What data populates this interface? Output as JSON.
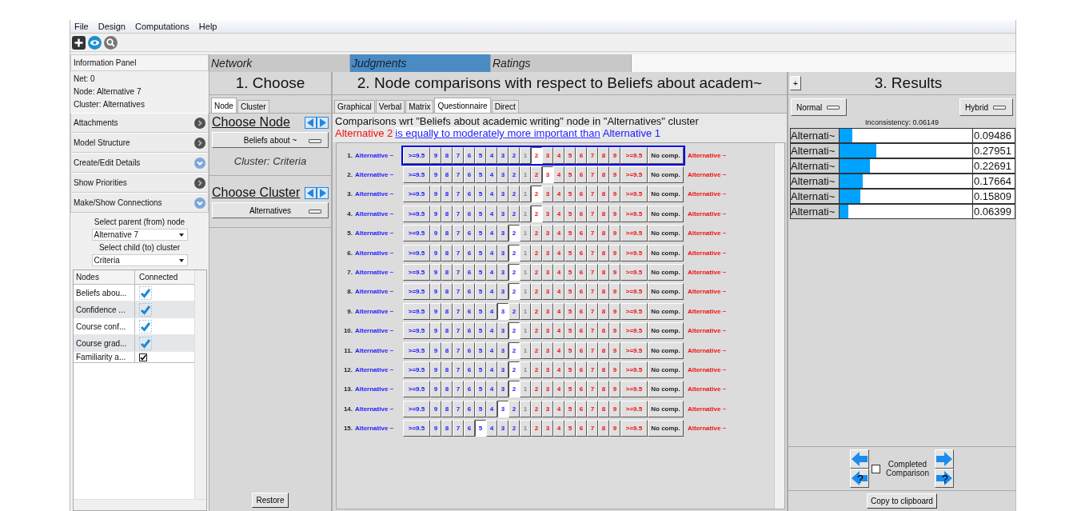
{
  "menu": [
    "File",
    "Design",
    "Computations",
    "Help"
  ],
  "info_panel": {
    "title": "Information Panel",
    "lines": [
      "Net: 0",
      "Node: Alternative 7",
      "Cluster: Alternatives"
    ]
  },
  "sections": [
    {
      "label": "Attachments",
      "highlighted": false
    },
    {
      "label": "Model Structure",
      "highlighted": false
    },
    {
      "label": "Create/Edit Details",
      "highlighted": true
    },
    {
      "label": "Show Priorities",
      "highlighted": false
    },
    {
      "label": "Make/Show Connections",
      "highlighted": true
    }
  ],
  "connections": {
    "parent_label": "Select parent (from) node",
    "parent_value": "Alternative 7",
    "child_label": "Select child (to) cluster",
    "child_value": "Criteria",
    "columns": [
      "Nodes",
      "Connected"
    ],
    "rows": [
      {
        "node": "Beliefs abou...",
        "checked": true,
        "kind": "tick"
      },
      {
        "node": "Confidence ...",
        "checked": true,
        "kind": "tick"
      },
      {
        "node": "Course conf...",
        "checked": true,
        "kind": "tick"
      },
      {
        "node": "Course grad...",
        "checked": true,
        "kind": "tick"
      },
      {
        "node": "Familiarity a...",
        "checked": true,
        "kind": "checkbox"
      }
    ]
  },
  "main_tabs": [
    {
      "label": "Network",
      "selected": false
    },
    {
      "label": "Judgments",
      "selected": true
    },
    {
      "label": "Ratings",
      "selected": false
    }
  ],
  "choose": {
    "title": "1. Choose",
    "tabs": [
      {
        "label": "Node",
        "selected": true
      },
      {
        "label": "Cluster",
        "selected": false
      }
    ],
    "node_heading": "Choose Node",
    "node_value": "Beliefs about ~",
    "cluster_note": "Cluster: Criteria",
    "cluster_heading": "Choose Cluster",
    "cluster_value": "Alternatives",
    "restore": "Restore"
  },
  "comparisons": {
    "title": "2. Node comparisons with respect to Beliefs about academ~",
    "tabs": [
      {
        "label": "Graphical",
        "selected": false
      },
      {
        "label": "Verbal",
        "selected": false
      },
      {
        "label": "Matrix",
        "selected": false
      },
      {
        "label": "Questionnaire",
        "selected": true
      },
      {
        "label": "Direct",
        "selected": false
      }
    ],
    "description": "Comparisons wrt \"Beliefs about academic writing\" node in \"Alternatives\" cluster",
    "verbal": {
      "left": "Alternative 2",
      "link": "is equally to moderately more important than",
      "right": "Alternative 1"
    },
    "rows": [
      {
        "number": "1.",
        "left": "Alternative ~",
        "right": "Alternative ~",
        "focused": true,
        "left_buttons": [
          {
            "label": ">=9.5",
            "selected": false
          },
          {
            "label": "9",
            "selected": false
          },
          {
            "label": "8",
            "selected": false
          },
          {
            "label": "7",
            "selected": false
          },
          {
            "label": "6",
            "selected": false
          },
          {
            "label": "5",
            "selected": false
          },
          {
            "label": "4",
            "selected": false
          },
          {
            "label": "3",
            "selected": false
          },
          {
            "label": "2",
            "selected": false
          }
        ],
        "center_button": {
          "label": "1",
          "selected": false
        },
        "right_buttons": [
          {
            "label": "2",
            "selected": true
          },
          {
            "label": "3",
            "selected": false
          },
          {
            "label": "4",
            "selected": false
          },
          {
            "label": "5",
            "selected": false
          },
          {
            "label": "6",
            "selected": false
          },
          {
            "label": "7",
            "selected": false
          },
          {
            "label": "8",
            "selected": false
          },
          {
            "label": "9",
            "selected": false
          },
          {
            "label": ">=9.5",
            "selected": false
          }
        ],
        "no_comp_button": {
          "label": "No comp.",
          "selected": false
        }
      },
      {
        "number": "2.",
        "left": "Alternative ~",
        "right": "Alternative ~",
        "focused": false,
        "left_buttons": [
          {
            "label": ">=9.5",
            "selected": false
          },
          {
            "label": "9",
            "selected": false
          },
          {
            "label": "8",
            "selected": false
          },
          {
            "label": "7",
            "selected": false
          },
          {
            "label": "6",
            "selected": false
          },
          {
            "label": "5",
            "selected": false
          },
          {
            "label": "4",
            "selected": false
          },
          {
            "label": "3",
            "selected": false
          },
          {
            "label": "2",
            "selected": false
          }
        ],
        "center_button": {
          "label": "1",
          "selected": false
        },
        "right_buttons": [
          {
            "label": "2",
            "selected": false
          },
          {
            "label": "3",
            "selected": true
          },
          {
            "label": "4",
            "selected": false
          },
          {
            "label": "5",
            "selected": false
          },
          {
            "label": "6",
            "selected": false
          },
          {
            "label": "7",
            "selected": false
          },
          {
            "label": "8",
            "selected": false
          },
          {
            "label": "9",
            "selected": false
          },
          {
            "label": ">=9.5",
            "selected": false
          }
        ],
        "no_comp_button": {
          "label": "No comp.",
          "selected": false
        }
      },
      {
        "number": "3.",
        "left": "Alternative ~",
        "right": "Alternative ~",
        "focused": false,
        "left_buttons": [
          {
            "label": ">=9.5",
            "selected": false
          },
          {
            "label": "9",
            "selected": false
          },
          {
            "label": "8",
            "selected": false
          },
          {
            "label": "7",
            "selected": false
          },
          {
            "label": "6",
            "selected": false
          },
          {
            "label": "5",
            "selected": false
          },
          {
            "label": "4",
            "selected": false
          },
          {
            "label": "3",
            "selected": false
          },
          {
            "label": "2",
            "selected": false
          }
        ],
        "center_button": {
          "label": "1",
          "selected": false
        },
        "right_buttons": [
          {
            "label": "2",
            "selected": true
          },
          {
            "label": "3",
            "selected": false
          },
          {
            "label": "4",
            "selected": false
          },
          {
            "label": "5",
            "selected": false
          },
          {
            "label": "6",
            "selected": false
          },
          {
            "label": "7",
            "selected": false
          },
          {
            "label": "8",
            "selected": false
          },
          {
            "label": "9",
            "selected": false
          },
          {
            "label": ">=9.5",
            "selected": false
          }
        ],
        "no_comp_button": {
          "label": "No comp.",
          "selected": false
        }
      },
      {
        "number": "4.",
        "left": "Alternative ~",
        "right": "Alternative ~",
        "focused": false,
        "left_buttons": [
          {
            "label": ">=9.5",
            "selected": false
          },
          {
            "label": "9",
            "selected": false
          },
          {
            "label": "8",
            "selected": false
          },
          {
            "label": "7",
            "selected": false
          },
          {
            "label": "6",
            "selected": false
          },
          {
            "label": "5",
            "selected": false
          },
          {
            "label": "4",
            "selected": false
          },
          {
            "label": "3",
            "selected": false
          },
          {
            "label": "2",
            "selected": false
          }
        ],
        "center_button": {
          "label": "1",
          "selected": false
        },
        "right_buttons": [
          {
            "label": "2",
            "selected": true
          },
          {
            "label": "3",
            "selected": false
          },
          {
            "label": "4",
            "selected": false
          },
          {
            "label": "5",
            "selected": false
          },
          {
            "label": "6",
            "selected": false
          },
          {
            "label": "7",
            "selected": false
          },
          {
            "label": "8",
            "selected": false
          },
          {
            "label": "9",
            "selected": false
          },
          {
            "label": ">=9.5",
            "selected": false
          }
        ],
        "no_comp_button": {
          "label": "No comp.",
          "selected": false
        }
      },
      {
        "number": "5.",
        "left": "Alternative ~",
        "right": "Alternative ~",
        "focused": false,
        "left_buttons": [
          {
            "label": ">=9.5",
            "selected": false
          },
          {
            "label": "9",
            "selected": false
          },
          {
            "label": "8",
            "selected": false
          },
          {
            "label": "7",
            "selected": false
          },
          {
            "label": "6",
            "selected": false
          },
          {
            "label": "5",
            "selected": false
          },
          {
            "label": "4",
            "selected": false
          },
          {
            "label": "3",
            "selected": false
          },
          {
            "label": "2",
            "selected": true
          }
        ],
        "center_button": {
          "label": "1",
          "selected": false
        },
        "right_buttons": [
          {
            "label": "2",
            "selected": false
          },
          {
            "label": "3",
            "selected": false
          },
          {
            "label": "4",
            "selected": false
          },
          {
            "label": "5",
            "selected": false
          },
          {
            "label": "6",
            "selected": false
          },
          {
            "label": "7",
            "selected": false
          },
          {
            "label": "8",
            "selected": false
          },
          {
            "label": "9",
            "selected": false
          },
          {
            "label": ">=9.5",
            "selected": false
          }
        ],
        "no_comp_button": {
          "label": "No comp.",
          "selected": false
        }
      },
      {
        "number": "6.",
        "left": "Alternative ~",
        "right": "Alternative ~",
        "focused": false,
        "left_buttons": [
          {
            "label": ">=9.5",
            "selected": false
          },
          {
            "label": "9",
            "selected": false
          },
          {
            "label": "8",
            "selected": false
          },
          {
            "label": "7",
            "selected": false
          },
          {
            "label": "6",
            "selected": false
          },
          {
            "label": "5",
            "selected": false
          },
          {
            "label": "4",
            "selected": false
          },
          {
            "label": "3",
            "selected": false
          },
          {
            "label": "2",
            "selected": true
          }
        ],
        "center_button": {
          "label": "1",
          "selected": false
        },
        "right_buttons": [
          {
            "label": "2",
            "selected": false
          },
          {
            "label": "3",
            "selected": false
          },
          {
            "label": "4",
            "selected": false
          },
          {
            "label": "5",
            "selected": false
          },
          {
            "label": "6",
            "selected": false
          },
          {
            "label": "7",
            "selected": false
          },
          {
            "label": "8",
            "selected": false
          },
          {
            "label": "9",
            "selected": false
          },
          {
            "label": ">=9.5",
            "selected": false
          }
        ],
        "no_comp_button": {
          "label": "No comp.",
          "selected": false
        }
      },
      {
        "number": "7.",
        "left": "Alternative ~",
        "right": "Alternative ~",
        "focused": false,
        "left_buttons": [
          {
            "label": ">=9.5",
            "selected": false
          },
          {
            "label": "9",
            "selected": false
          },
          {
            "label": "8",
            "selected": false
          },
          {
            "label": "7",
            "selected": false
          },
          {
            "label": "6",
            "selected": false
          },
          {
            "label": "5",
            "selected": false
          },
          {
            "label": "4",
            "selected": false
          },
          {
            "label": "3",
            "selected": false
          },
          {
            "label": "2",
            "selected": true
          }
        ],
        "center_button": {
          "label": "1",
          "selected": false
        },
        "right_buttons": [
          {
            "label": "2",
            "selected": false
          },
          {
            "label": "3",
            "selected": false
          },
          {
            "label": "4",
            "selected": false
          },
          {
            "label": "5",
            "selected": false
          },
          {
            "label": "6",
            "selected": false
          },
          {
            "label": "7",
            "selected": false
          },
          {
            "label": "8",
            "selected": false
          },
          {
            "label": "9",
            "selected": false
          },
          {
            "label": ">=9.5",
            "selected": false
          }
        ],
        "no_comp_button": {
          "label": "No comp.",
          "selected": false
        }
      },
      {
        "number": "8.",
        "left": "Alternative ~",
        "right": "Alternative ~",
        "focused": false,
        "left_buttons": [
          {
            "label": ">=9.5",
            "selected": false
          },
          {
            "label": "9",
            "selected": false
          },
          {
            "label": "8",
            "selected": false
          },
          {
            "label": "7",
            "selected": false
          },
          {
            "label": "6",
            "selected": false
          },
          {
            "label": "5",
            "selected": false
          },
          {
            "label": "4",
            "selected": false
          },
          {
            "label": "3",
            "selected": false
          },
          {
            "label": "2",
            "selected": true
          }
        ],
        "center_button": {
          "label": "1",
          "selected": false
        },
        "right_buttons": [
          {
            "label": "2",
            "selected": false
          },
          {
            "label": "3",
            "selected": false
          },
          {
            "label": "4",
            "selected": false
          },
          {
            "label": "5",
            "selected": false
          },
          {
            "label": "6",
            "selected": false
          },
          {
            "label": "7",
            "selected": false
          },
          {
            "label": "8",
            "selected": false
          },
          {
            "label": "9",
            "selected": false
          },
          {
            "label": ">=9.5",
            "selected": false
          }
        ],
        "no_comp_button": {
          "label": "No comp.",
          "selected": false
        }
      },
      {
        "number": "9.",
        "left": "Alternative ~",
        "right": "Alternative ~",
        "focused": false,
        "left_buttons": [
          {
            "label": ">=9.5",
            "selected": false
          },
          {
            "label": "9",
            "selected": false
          },
          {
            "label": "8",
            "selected": false
          },
          {
            "label": "7",
            "selected": false
          },
          {
            "label": "6",
            "selected": false
          },
          {
            "label": "5",
            "selected": false
          },
          {
            "label": "4",
            "selected": false
          },
          {
            "label": "3",
            "selected": true
          },
          {
            "label": "2",
            "selected": false
          }
        ],
        "center_button": {
          "label": "1",
          "selected": false
        },
        "right_buttons": [
          {
            "label": "2",
            "selected": false
          },
          {
            "label": "3",
            "selected": false
          },
          {
            "label": "4",
            "selected": false
          },
          {
            "label": "5",
            "selected": false
          },
          {
            "label": "6",
            "selected": false
          },
          {
            "label": "7",
            "selected": false
          },
          {
            "label": "8",
            "selected": false
          },
          {
            "label": "9",
            "selected": false
          },
          {
            "label": ">=9.5",
            "selected": false
          }
        ],
        "no_comp_button": {
          "label": "No comp.",
          "selected": false
        }
      },
      {
        "number": "10.",
        "left": "Alternative ~",
        "right": "Alternative ~",
        "focused": false,
        "left_buttons": [
          {
            "label": ">=9.5",
            "selected": false
          },
          {
            "label": "9",
            "selected": false
          },
          {
            "label": "8",
            "selected": false
          },
          {
            "label": "7",
            "selected": false
          },
          {
            "label": "6",
            "selected": false
          },
          {
            "label": "5",
            "selected": false
          },
          {
            "label": "4",
            "selected": false
          },
          {
            "label": "3",
            "selected": false
          },
          {
            "label": "2",
            "selected": true
          }
        ],
        "center_button": {
          "label": "1",
          "selected": false
        },
        "right_buttons": [
          {
            "label": "2",
            "selected": false
          },
          {
            "label": "3",
            "selected": false
          },
          {
            "label": "4",
            "selected": false
          },
          {
            "label": "5",
            "selected": false
          },
          {
            "label": "6",
            "selected": false
          },
          {
            "label": "7",
            "selected": false
          },
          {
            "label": "8",
            "selected": false
          },
          {
            "label": "9",
            "selected": false
          },
          {
            "label": ">=9.5",
            "selected": false
          }
        ],
        "no_comp_button": {
          "label": "No comp.",
          "selected": false
        }
      },
      {
        "number": "11.",
        "left": "Alternative ~",
        "right": "Alternative ~",
        "focused": false,
        "left_buttons": [
          {
            "label": ">=9.5",
            "selected": false
          },
          {
            "label": "9",
            "selected": false
          },
          {
            "label": "8",
            "selected": false
          },
          {
            "label": "7",
            "selected": false
          },
          {
            "label": "6",
            "selected": false
          },
          {
            "label": "5",
            "selected": false
          },
          {
            "label": "4",
            "selected": false
          },
          {
            "label": "3",
            "selected": false
          },
          {
            "label": "2",
            "selected": true
          }
        ],
        "center_button": {
          "label": "1",
          "selected": false
        },
        "right_buttons": [
          {
            "label": "2",
            "selected": false
          },
          {
            "label": "3",
            "selected": false
          },
          {
            "label": "4",
            "selected": false
          },
          {
            "label": "5",
            "selected": false
          },
          {
            "label": "6",
            "selected": false
          },
          {
            "label": "7",
            "selected": false
          },
          {
            "label": "8",
            "selected": false
          },
          {
            "label": "9",
            "selected": false
          },
          {
            "label": ">=9.5",
            "selected": false
          }
        ],
        "no_comp_button": {
          "label": "No comp.",
          "selected": false
        }
      },
      {
        "number": "12.",
        "left": "Alternative ~",
        "right": "Alternative ~",
        "focused": false,
        "left_buttons": [
          {
            "label": ">=9.5",
            "selected": false
          },
          {
            "label": "9",
            "selected": false
          },
          {
            "label": "8",
            "selected": false
          },
          {
            "label": "7",
            "selected": false
          },
          {
            "label": "6",
            "selected": false
          },
          {
            "label": "5",
            "selected": false
          },
          {
            "label": "4",
            "selected": false
          },
          {
            "label": "3",
            "selected": false
          },
          {
            "label": "2",
            "selected": true
          }
        ],
        "center_button": {
          "label": "1",
          "selected": false
        },
        "right_buttons": [
          {
            "label": "2",
            "selected": false
          },
          {
            "label": "3",
            "selected": false
          },
          {
            "label": "4",
            "selected": false
          },
          {
            "label": "5",
            "selected": false
          },
          {
            "label": "6",
            "selected": false
          },
          {
            "label": "7",
            "selected": false
          },
          {
            "label": "8",
            "selected": false
          },
          {
            "label": "9",
            "selected": false
          },
          {
            "label": ">=9.5",
            "selected": false
          }
        ],
        "no_comp_button": {
          "label": "No comp.",
          "selected": false
        }
      },
      {
        "number": "13.",
        "left": "Alternative ~",
        "right": "Alternative ~",
        "focused": false,
        "left_buttons": [
          {
            "label": ">=9.5",
            "selected": false
          },
          {
            "label": "9",
            "selected": false
          },
          {
            "label": "8",
            "selected": false
          },
          {
            "label": "7",
            "selected": false
          },
          {
            "label": "6",
            "selected": false
          },
          {
            "label": "5",
            "selected": false
          },
          {
            "label": "4",
            "selected": false
          },
          {
            "label": "3",
            "selected": false
          },
          {
            "label": "2",
            "selected": true
          }
        ],
        "center_button": {
          "label": "1",
          "selected": false
        },
        "right_buttons": [
          {
            "label": "2",
            "selected": false
          },
          {
            "label": "3",
            "selected": false
          },
          {
            "label": "4",
            "selected": false
          },
          {
            "label": "5",
            "selected": false
          },
          {
            "label": "6",
            "selected": false
          },
          {
            "label": "7",
            "selected": false
          },
          {
            "label": "8",
            "selected": false
          },
          {
            "label": "9",
            "selected": false
          },
          {
            "label": ">=9.5",
            "selected": false
          }
        ],
        "no_comp_button": {
          "label": "No comp.",
          "selected": false
        }
      },
      {
        "number": "14.",
        "left": "Alternative ~",
        "right": "Alternative ~",
        "focused": false,
        "left_buttons": [
          {
            "label": ">=9.5",
            "selected": false
          },
          {
            "label": "9",
            "selected": false
          },
          {
            "label": "8",
            "selected": false
          },
          {
            "label": "7",
            "selected": false
          },
          {
            "label": "6",
            "selected": false
          },
          {
            "label": "5",
            "selected": false
          },
          {
            "label": "4",
            "selected": false
          },
          {
            "label": "3",
            "selected": true
          },
          {
            "label": "2",
            "selected": false
          }
        ],
        "center_button": {
          "label": "1",
          "selected": false
        },
        "right_buttons": [
          {
            "label": "2",
            "selected": false
          },
          {
            "label": "3",
            "selected": false
          },
          {
            "label": "4",
            "selected": false
          },
          {
            "label": "5",
            "selected": false
          },
          {
            "label": "6",
            "selected": false
          },
          {
            "label": "7",
            "selected": false
          },
          {
            "label": "8",
            "selected": false
          },
          {
            "label": "9",
            "selected": false
          },
          {
            "label": ">=9.5",
            "selected": false
          }
        ],
        "no_comp_button": {
          "label": "No comp.",
          "selected": false
        }
      },
      {
        "number": "15.",
        "left": "Alternative ~",
        "right": "Alternative ~",
        "focused": false,
        "left_buttons": [
          {
            "label": ">=9.5",
            "selected": false
          },
          {
            "label": "9",
            "selected": false
          },
          {
            "label": "8",
            "selected": false
          },
          {
            "label": "7",
            "selected": false
          },
          {
            "label": "6",
            "selected": false
          },
          {
            "label": "5",
            "selected": true
          },
          {
            "label": "4",
            "selected": false
          },
          {
            "label": "3",
            "selected": false
          },
          {
            "label": "2",
            "selected": false
          }
        ],
        "center_button": {
          "label": "1",
          "selected": false
        },
        "right_buttons": [
          {
            "label": "2",
            "selected": false
          },
          {
            "label": "3",
            "selected": false
          },
          {
            "label": "4",
            "selected": false
          },
          {
            "label": "5",
            "selected": false
          },
          {
            "label": "6",
            "selected": false
          },
          {
            "label": "7",
            "selected": false
          },
          {
            "label": "8",
            "selected": false
          },
          {
            "label": "9",
            "selected": false
          },
          {
            "label": ">=9.5",
            "selected": false
          }
        ],
        "no_comp_button": {
          "label": "No comp.",
          "selected": false
        }
      }
    ]
  },
  "results": {
    "expand": "+",
    "title": "3. Results",
    "mode": "Normal",
    "view": "Hybrid",
    "inconsistency": "Inconsistency: 0.06149",
    "rows": [
      {
        "label": "Alternati~",
        "level": 0.095,
        "value": "0.09486"
      },
      {
        "label": "Alternati~",
        "level": 0.28,
        "value": "0.27951"
      },
      {
        "label": "Alternati~",
        "level": 0.227,
        "value": "0.22691"
      },
      {
        "label": "Alternati~",
        "level": 0.177,
        "value": "0.17664"
      },
      {
        "label": "Alternati~",
        "level": 0.158,
        "value": "0.15809"
      },
      {
        "label": "Alternati~",
        "level": 0.064,
        "value": "0.06399"
      }
    ],
    "prev_help": "?",
    "next_help": "?",
    "completed": {
      "label": "Completed Comparison",
      "checked": false
    },
    "copy": "Copy to clipboard"
  }
}
